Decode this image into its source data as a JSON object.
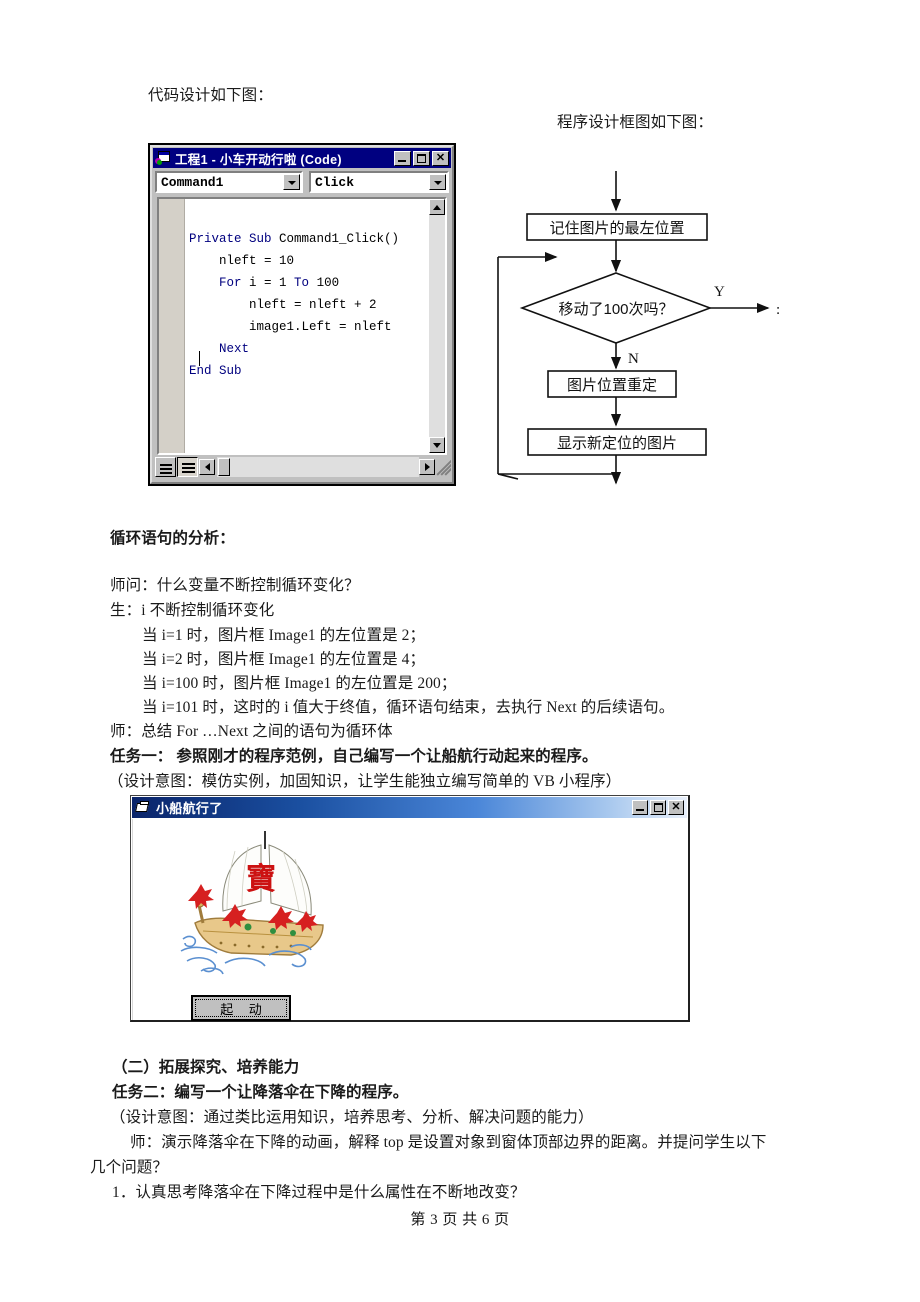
{
  "document": {
    "heading_left": "代码设计如下图：",
    "heading_right": "程序设计框图如下图：",
    "section_loop_analysis": "循环语句的分析：",
    "lines": [
      "师问：什么变量不断控制循环变化？",
      "生：i 不断控制循环变化",
      "当 i=1 时，图片框 Image1 的左位置是 2；",
      "当 i=2 时，图片框 Image1 的左位置是 4；",
      "当 i=100 时，图片框 Image1 的左位置是 200；",
      "当 i=101 时，这时的 i 值大于终值，循环语句结束，去执行 Next 的后续语句。",
      "师：总结 For …Next 之间的语句为循环体"
    ],
    "task_one": "任务一： 参照刚才的程序范例，自己编写一个让船航行动起来的程序。",
    "task_one_note": "（设计意图：模仿实例，加固知识，让学生能独立编写简单的 VB 小程序）",
    "section_two_title": "（二）拓展探究、培养能力",
    "task_two": "任务二：编写一个让降落伞在下降的程序。",
    "task_two_note": "（设计意图：通过类比运用知识，培养思考、分析、解决问题的能力）",
    "teacher_demo_line1": "师：演示降落伞在下降的动画，解释 top 是设置对象到窗体顶部边界的距离。并提问学生以下",
    "teacher_demo_line2": "几个问题？",
    "question_1": "1．认真思考降落伞在下降过程中是什么属性在不断地改变？",
    "footer": "第 3 页 共 6 页"
  },
  "code_window": {
    "title": "工程1 - 小车开动行啦 (Code)",
    "object_combo": "Command1",
    "event_combo": "Click",
    "minimize_label": "_",
    "maximize_label": "□",
    "close_label": "✕",
    "code_lines": [
      {
        "indent": 0,
        "parts": [
          {
            "t": "Private Sub ",
            "kw": true
          },
          {
            "t": "Command1_Click()",
            "kw": false
          }
        ]
      },
      {
        "indent": 1,
        "parts": [
          {
            "t": "nleft = 10",
            "kw": false
          }
        ]
      },
      {
        "indent": 1,
        "parts": [
          {
            "t": "For ",
            "kw": true
          },
          {
            "t": "i = 1 ",
            "kw": false
          },
          {
            "t": "To ",
            "kw": true
          },
          {
            "t": "100",
            "kw": false
          }
        ]
      },
      {
        "indent": 2,
        "parts": [
          {
            "t": "nleft = nleft + 2",
            "kw": false
          }
        ]
      },
      {
        "indent": 2,
        "parts": [
          {
            "t": "image1.Left = nleft",
            "kw": false
          }
        ]
      },
      {
        "indent": 1,
        "parts": [
          {
            "t": "Next",
            "kw": true
          }
        ]
      },
      {
        "indent": 0,
        "parts": [
          {
            "t": "End Sub",
            "kw": true
          }
        ]
      }
    ],
    "colors": {
      "titlebar": "#000080",
      "keyword": "#00007f",
      "face": "#c0c0c0"
    }
  },
  "flowchart": {
    "nodes": [
      {
        "id": "remember",
        "shape": "rect",
        "label": "记住图片的最左位置"
      },
      {
        "id": "decision",
        "shape": "diamond",
        "label": "移动了100次吗？"
      },
      {
        "id": "reposition",
        "shape": "rect",
        "label": "图片位置重定"
      },
      {
        "id": "display",
        "shape": "rect",
        "label": "显示新定位的图片"
      }
    ],
    "branch_yes": "Y",
    "branch_no": "N",
    "tail_marker": ":"
  },
  "boat_window": {
    "title": "小船航行了",
    "minimize_label": "_",
    "maximize_label": "□",
    "close_label": "✕",
    "start_button": "起 动",
    "image_alt": "sailing-boat-illustration",
    "sail_character": "寶",
    "colors": {
      "title_start": "#0a246a",
      "title_end": "#e8effa",
      "sail_char": "#cc1111"
    }
  }
}
